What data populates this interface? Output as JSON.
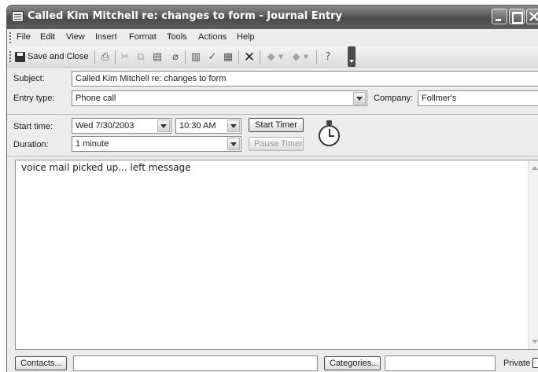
{
  "window": {
    "title": "Called Kim Mitchell re: changes to form - Journal Entry"
  },
  "menu": [
    "File",
    "Edit",
    "View",
    "Insert",
    "Format",
    "Tools",
    "Actions",
    "Help"
  ],
  "toolbar": {
    "save_close_label": "Save and Close",
    "icons": [
      "print-icon",
      "cut-icon",
      "copy-icon",
      "paste-icon",
      "attach-icon",
      "address-book-icon",
      "check-names-icon",
      "options-icon",
      "delete-icon",
      "previous-item-icon",
      "next-item-icon",
      "help-icon"
    ]
  },
  "form": {
    "subject_label": "Subject:",
    "subject_value": "Called Kim Mitchell re: changes to form",
    "entry_type_label": "Entry type:",
    "entry_type_value": "Phone call",
    "company_label": "Company:",
    "company_value": "Follmer's",
    "start_time_label": "Start time:",
    "start_date_value": "Wed 7/30/2003",
    "start_time_value": "10:30 AM",
    "start_timer_label": "Start Timer",
    "duration_label": "Duration:",
    "duration_value": "1 minute",
    "pause_timer_label": "Pause Timer"
  },
  "notes": {
    "text": "voice mail picked up... left message"
  },
  "footer": {
    "contacts_label": "Contacts...",
    "contacts_value": "",
    "categories_label": "Categories...",
    "categories_value": "",
    "private_label": "Private"
  }
}
